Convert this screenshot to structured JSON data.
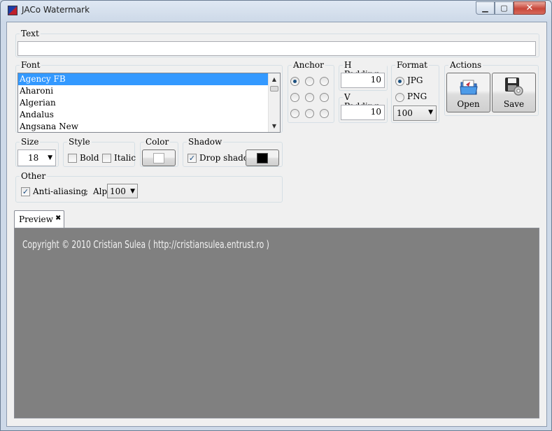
{
  "window": {
    "title": "JACo Watermark",
    "minimize": "▭",
    "maximize": "▢",
    "close": "✕"
  },
  "text_group": {
    "label": "Text",
    "value": ""
  },
  "font_group": {
    "label": "Font",
    "items": [
      "Agency FB",
      "Aharoni",
      "Algerian",
      "Andalus",
      "Angsana New"
    ],
    "selected_index": 0
  },
  "anchor": {
    "label": "Anchor",
    "selected": "top-left"
  },
  "h_padding": {
    "label": "H Padding",
    "value": "10"
  },
  "v_padding": {
    "label": "V Padding",
    "value": "10"
  },
  "format": {
    "label": "Format",
    "options": [
      "JPG",
      "PNG"
    ],
    "selected": "JPG",
    "quality": "100"
  },
  "actions": {
    "label": "Actions",
    "open": "Open",
    "save": "Save"
  },
  "size": {
    "label": "Size",
    "value": "18"
  },
  "style": {
    "label": "Style",
    "bold": "Bold",
    "italic": "Italic",
    "bold_checked": false,
    "italic_checked": false
  },
  "color": {
    "label": "Color",
    "swatch": "#ffffff"
  },
  "shadow": {
    "label": "Shadow",
    "drop_shadow": "Drop shadow",
    "checked": true,
    "swatch": "#000000"
  },
  "other": {
    "label": "Other",
    "anti_aliasing": "Anti-aliasing",
    "separator": ";",
    "alpha_label": "Alpha:",
    "alpha_value": "100",
    "checked": true
  },
  "preview": {
    "tab_label": "Preview",
    "tab_close": "✖",
    "watermark_text": "Copyright © 2010 Cristian Sulea ( http://cristiansulea.entrust.ro )",
    "background": "#808080"
  }
}
